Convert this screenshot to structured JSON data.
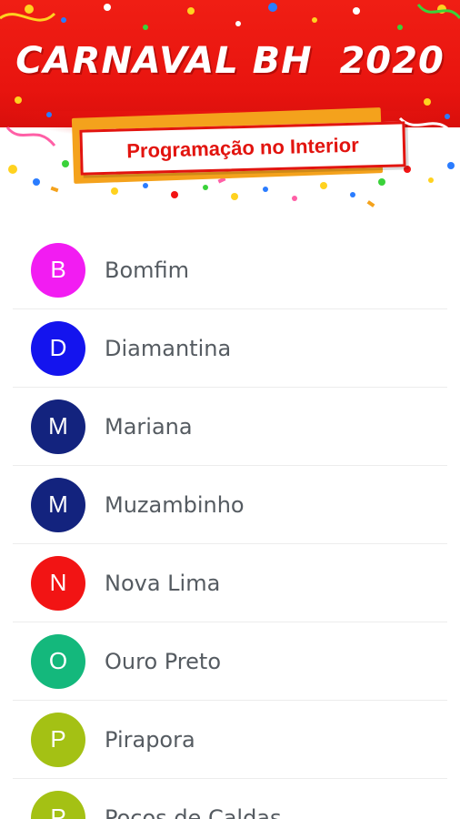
{
  "header": {
    "title": "CARNAVAL BH  2020",
    "subtitle": "Programação no Interior"
  },
  "list": {
    "items": [
      {
        "initial": "B",
        "label": "Bomfim",
        "color": "#f21cf2"
      },
      {
        "initial": "D",
        "label": "Diamantina",
        "color": "#1414ee"
      },
      {
        "initial": "M",
        "label": "Mariana",
        "color": "#13237e"
      },
      {
        "initial": "M",
        "label": "Muzambinho",
        "color": "#13237e"
      },
      {
        "initial": "N",
        "label": "Nova Lima",
        "color": "#f21414"
      },
      {
        "initial": "O",
        "label": "Ouro Preto",
        "color": "#14b87c"
      },
      {
        "initial": "P",
        "label": "Pirapora",
        "color": "#a4c114"
      },
      {
        "initial": "P",
        "label": "Poços de Caldas",
        "color": "#a4c114"
      }
    ]
  }
}
